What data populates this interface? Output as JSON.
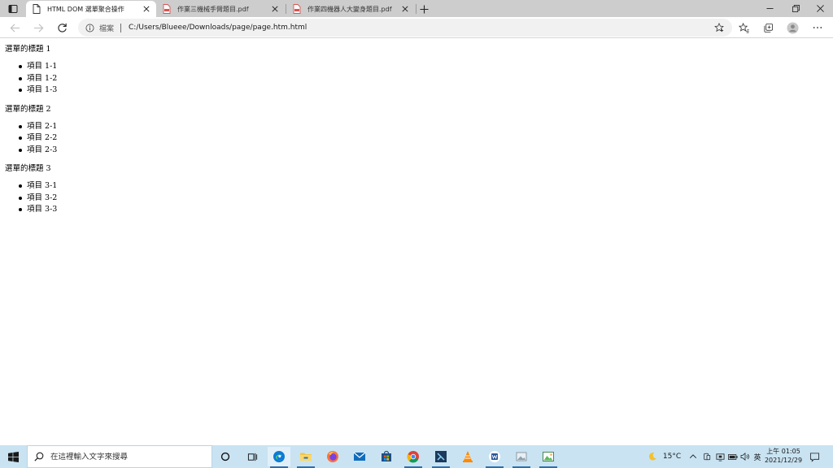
{
  "browser": {
    "tabs": [
      {
        "title": "HTML DOM 選單聚合操作",
        "icon": "page-icon",
        "active": true
      },
      {
        "title": "作業三機械手臂題目.pdf",
        "icon": "pdf-icon",
        "active": false
      },
      {
        "title": "作業四機器人大變身題目.pdf",
        "icon": "pdf-icon",
        "active": false
      }
    ],
    "address": {
      "scheme_label": "檔案",
      "url": "C:/Users/Blueee/Downloads/page/page.htm.html"
    }
  },
  "page": {
    "menus": [
      {
        "title": "選單的標題 1",
        "items": [
          "項目 1-1",
          "項目 1-2",
          "項目 1-3"
        ]
      },
      {
        "title": "選單的標題 2",
        "items": [
          "項目 2-1",
          "項目 2-2",
          "項目 2-3"
        ]
      },
      {
        "title": "選單的標題 3",
        "items": [
          "項目 3-1",
          "項目 3-2",
          "項目 3-3"
        ]
      }
    ]
  },
  "taskbar": {
    "search_placeholder": "在這裡輸入文字來搜尋",
    "weather": {
      "temperature": "15°C",
      "icon": "moon-icon"
    },
    "ime": "英",
    "clock": {
      "time": "上午 01:05",
      "date": "2021/12/29"
    }
  },
  "colors": {
    "tabstrip": "#cdcdcd",
    "taskbar": "#c9e3f2",
    "edge_blue": "#0c7bd6",
    "pdf_red": "#d9534f"
  }
}
